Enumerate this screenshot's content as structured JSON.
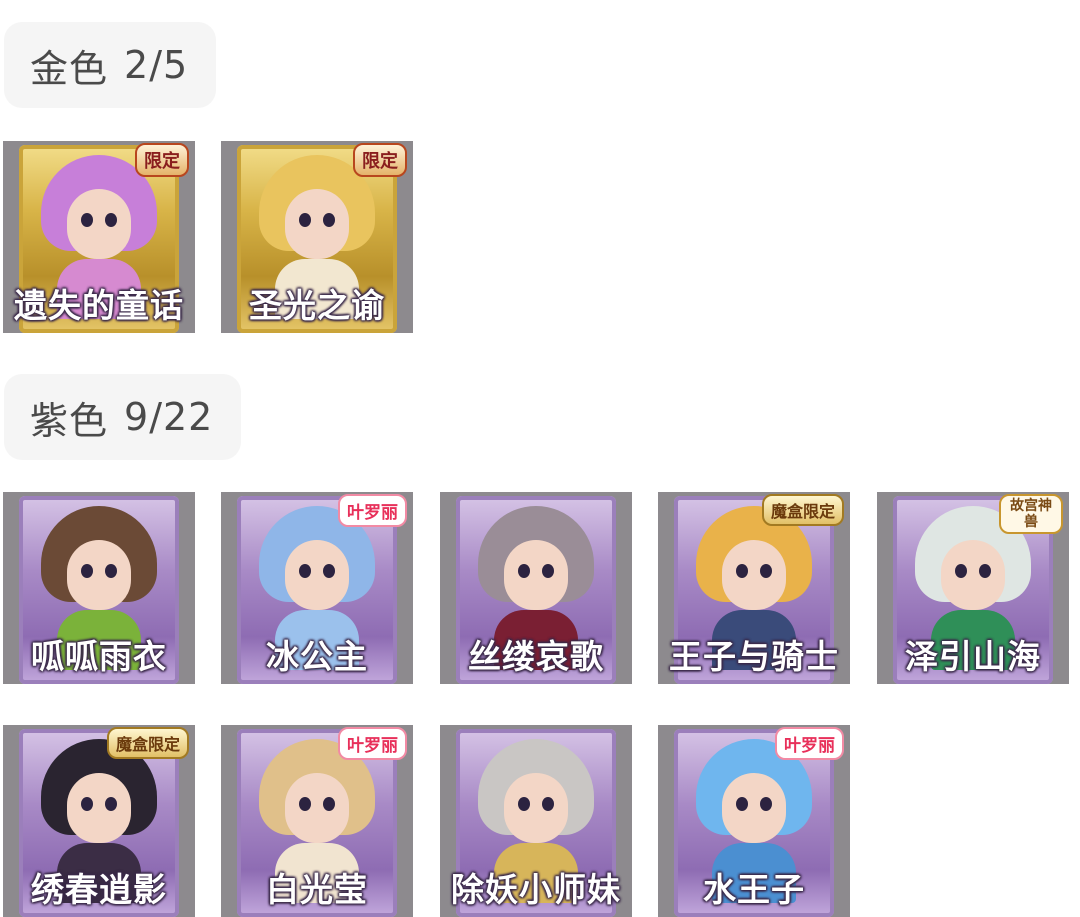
{
  "sections": [
    {
      "label": "金色",
      "count": "2/5"
    },
    {
      "label": "紫色",
      "count": "9/22"
    }
  ],
  "gold_items": [
    {
      "name": "遗失的童话",
      "badge": "限定",
      "hair": "#c77fd9",
      "body": "#d68ad0"
    },
    {
      "name": "圣光之谕",
      "badge": "限定",
      "hair": "#e9c45e",
      "body": "#f2e7d0"
    }
  ],
  "purple_items": [
    {
      "name": "呱呱雨衣",
      "badge": "",
      "hair": "#6b4a36",
      "body": "#7bb23a"
    },
    {
      "name": "冰公主",
      "badge": "叶罗丽",
      "hair": "#8fb6e8",
      "body": "#9bc1ec"
    },
    {
      "name": "丝缕哀歌",
      "badge": "",
      "hair": "#9a8d97",
      "body": "#7a1f33"
    },
    {
      "name": "王子与骑士",
      "badge": "魔盒限定",
      "hair": "#e9b24a",
      "body": "#3a4b7a"
    },
    {
      "name": "泽引山海",
      "badge": "故宫神兽",
      "hair": "#dfe6e3",
      "body": "#2f8f58"
    },
    {
      "name": "绣春逍影",
      "badge": "魔盒限定",
      "hair": "#2a2430",
      "body": "#3b2d45"
    },
    {
      "name": "白光莹",
      "badge": "叶罗丽",
      "hair": "#e0c08a",
      "body": "#f1e4d0"
    },
    {
      "name": "除妖小师妹",
      "badge": "",
      "hair": "#c9c6c4",
      "body": "#d7b55a"
    },
    {
      "name": "水王子",
      "badge": "叶罗丽",
      "hair": "#6fb6ee",
      "body": "#4b8fd1"
    }
  ]
}
